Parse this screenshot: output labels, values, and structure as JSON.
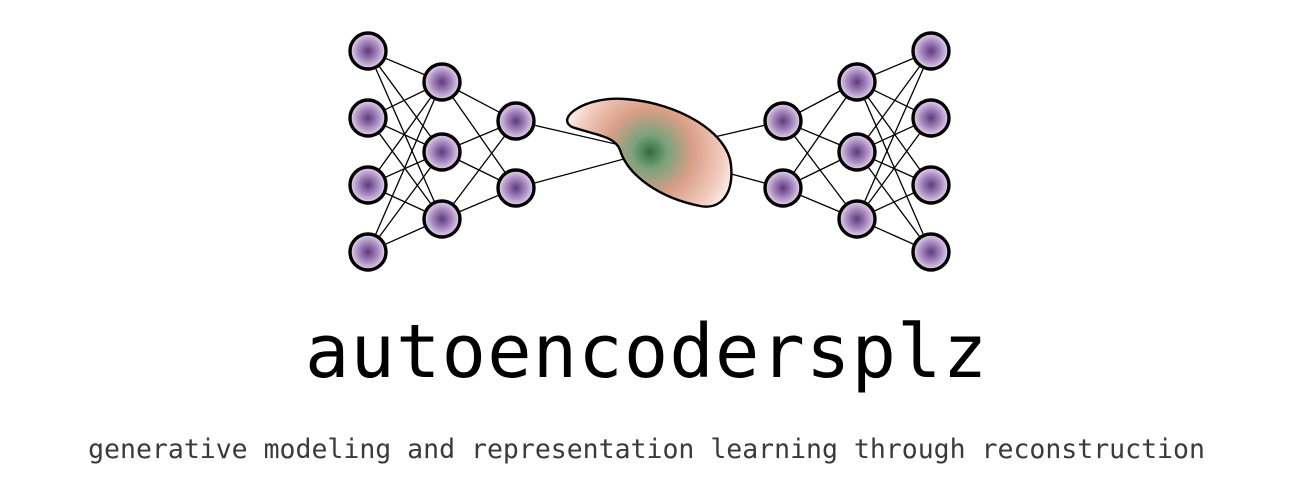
{
  "title": "autoencodersplz",
  "subtitle": "generative modeling and representation learning through reconstruction",
  "colors": {
    "node_center": "#5e3a7e",
    "node_edge": "#e6d8ee",
    "latent_center": "#3c7a4c",
    "latent_outer": "#e8a090",
    "text": "#000000"
  },
  "network": {
    "encoder_layer_sizes": [
      4,
      3,
      2
    ],
    "decoder_layer_sizes": [
      2,
      3,
      4
    ]
  }
}
